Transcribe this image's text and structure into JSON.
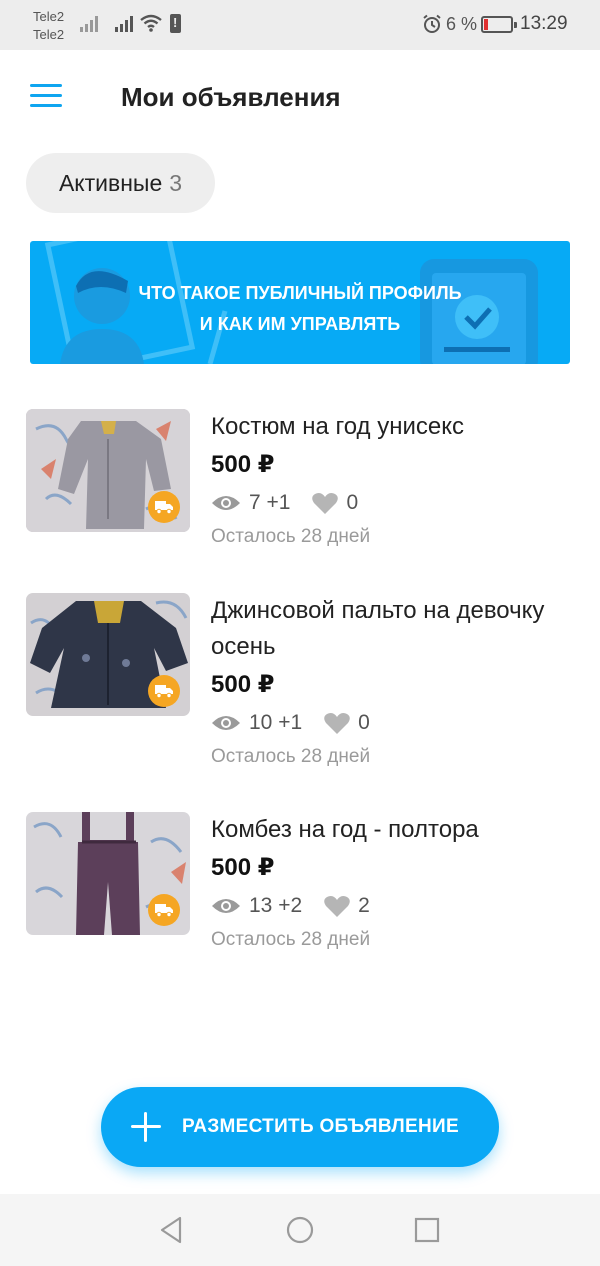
{
  "status_bar": {
    "carrier_1": "Tele2",
    "carrier_2": "Tele2",
    "battery_percent": "6 %",
    "time": "13:29"
  },
  "header": {
    "title": "Мои объявления",
    "menu_icon": "hamburger-menu-icon"
  },
  "filter": {
    "label": "Активные",
    "count": "3"
  },
  "banner": {
    "line_1": "ЧТО ТАКОЕ ПУБЛИЧНЫЙ ПРОФИЛЬ",
    "line_2": "И КАК ИМ УПРАВЛЯТЬ"
  },
  "listings": [
    {
      "title": "Костюм на год унисекс",
      "price": "500 ₽",
      "views": "7 +1",
      "favorites": "0",
      "remaining": "Осталось 28 дней"
    },
    {
      "title": "Джинсовой пальто на девочку осень",
      "price": "500 ₽",
      "views": "10 +1",
      "favorites": "0",
      "remaining": "Осталось 28 дней"
    },
    {
      "title": "Комбез на год - полтора",
      "price": "500 ₽",
      "views": "13 +2",
      "favorites": "2",
      "remaining": "Осталось 28 дней"
    }
  ],
  "fab": {
    "label": "РАЗМЕСТИТЬ ОБЪЯВЛЕНИЕ",
    "icon": "plus-icon"
  },
  "colors": {
    "accent": "#0aa8f5",
    "delivery_badge": "#f5a623",
    "battery_low": "#e03030"
  }
}
